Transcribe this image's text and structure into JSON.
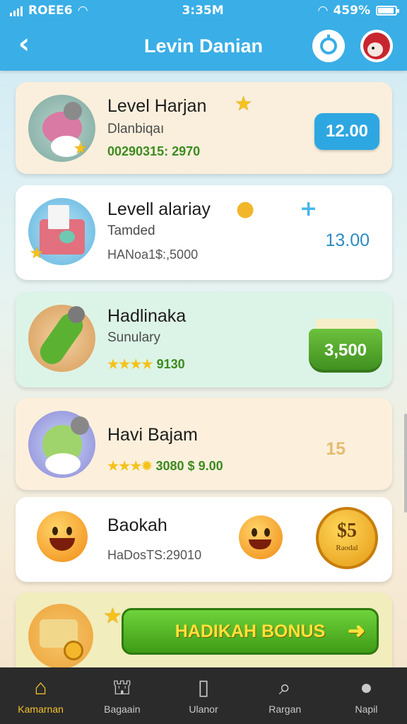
{
  "status_bar": {
    "carrier": "ROEE6",
    "time": "3:35M",
    "battery": "459%"
  },
  "header": {
    "title": "Levin Danian"
  },
  "cards": [
    {
      "title": "Level Harjan",
      "subtitle": "Dlanbiqaı",
      "meta": "00290315: 2970",
      "price": "12.00"
    },
    {
      "title": "Levell alariay",
      "subtitle": "Tamded",
      "meta": "HANoa1$:,5000",
      "price": "13.00"
    },
    {
      "title": "Hadlinaka",
      "subtitle": "Sunulary",
      "meta": "9130",
      "price": "3,500"
    },
    {
      "title": "Havi Bajam",
      "meta": "3080 $ 9.00",
      "price": "15"
    },
    {
      "title": "Baokah",
      "meta": "HaDosTS:29010",
      "coin_value": "$5",
      "coin_label": "Raodal"
    }
  ],
  "bonus": {
    "label": "HADIKAH BONUS"
  },
  "nav": [
    {
      "label": "Kamarnan",
      "icon": "home-icon"
    },
    {
      "label": "Bagaain",
      "icon": "store-icon"
    },
    {
      "label": "Ulanor",
      "icon": "clipboard-icon"
    },
    {
      "label": "Rargan",
      "icon": "search-icon"
    },
    {
      "label": "Napil",
      "icon": "profile-icon"
    }
  ],
  "colors": {
    "header": "#3aaee6",
    "nav_active": "#f4c22c",
    "price_button": "#2da7e2"
  }
}
